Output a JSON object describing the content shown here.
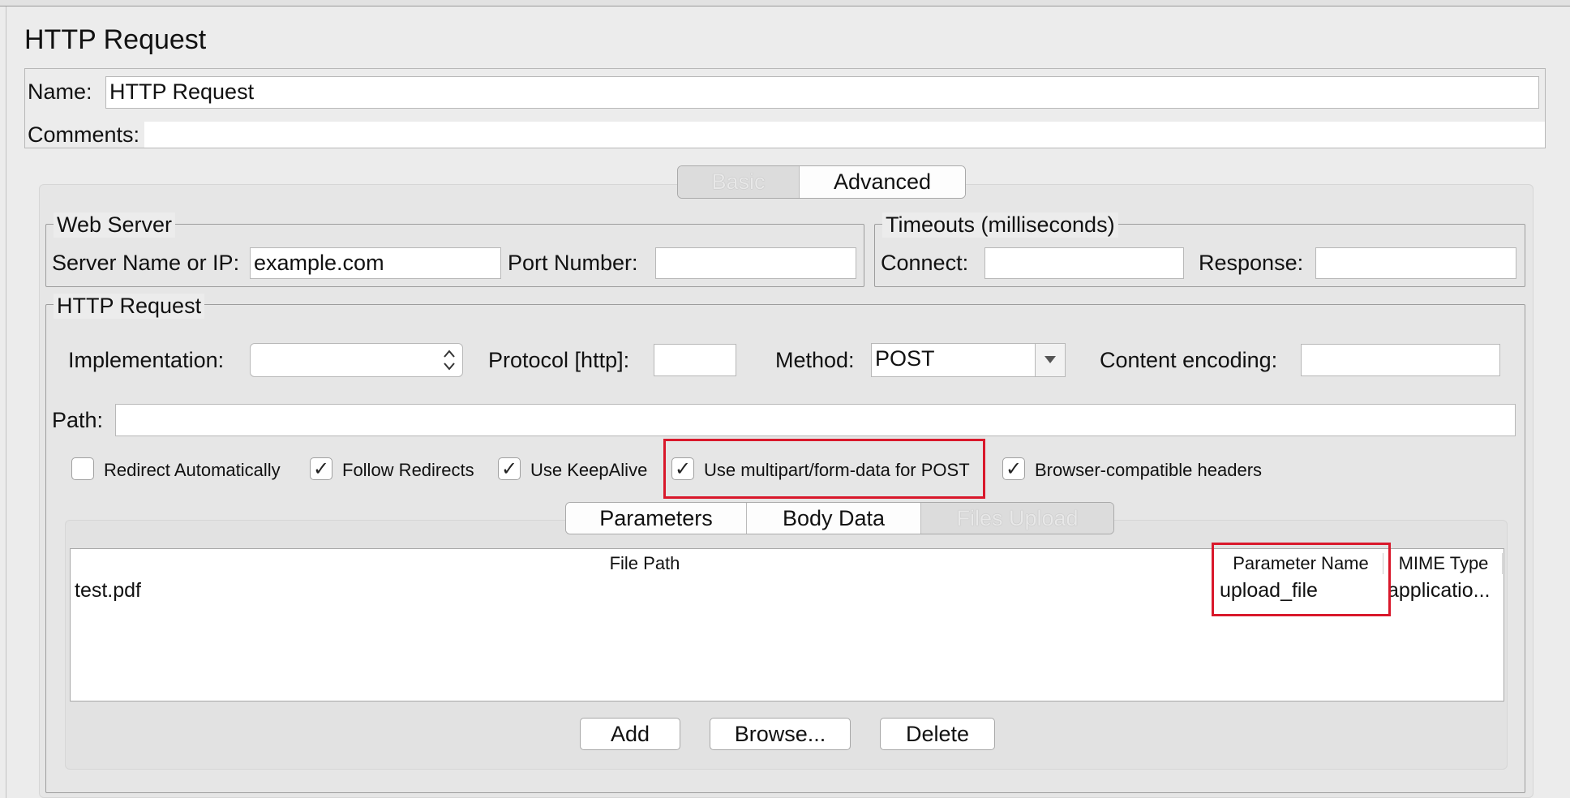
{
  "title": "HTTP Request",
  "name_label": "Name:",
  "name_value": "HTTP Request",
  "comments_label": "Comments:",
  "comments_value": "",
  "top_tabs": [
    {
      "label": "Basic",
      "disabled": true
    },
    {
      "label": "Advanced",
      "disabled": false
    }
  ],
  "web_server": {
    "legend": "Web Server",
    "server_label": "Server Name or IP:",
    "server_value": "example.com",
    "port_label": "Port Number:",
    "port_value": ""
  },
  "timeouts": {
    "legend": "Timeouts (milliseconds)",
    "connect_label": "Connect:",
    "connect_value": "",
    "response_label": "Response:",
    "response_value": ""
  },
  "http_request": {
    "legend": "HTTP Request",
    "implementation_label": "Implementation:",
    "implementation_value": "",
    "protocol_label": "Protocol [http]:",
    "protocol_value": "",
    "method_label": "Method:",
    "method_value": "POST",
    "encoding_label": "Content encoding:",
    "encoding_value": "",
    "path_label": "Path:",
    "path_value": ""
  },
  "checkboxes": [
    {
      "label": "Redirect Automatically",
      "checked": false
    },
    {
      "label": "Follow Redirects",
      "checked": true
    },
    {
      "label": "Use KeepAlive",
      "checked": true
    },
    {
      "label": "Use multipart/form-data for POST",
      "checked": true
    },
    {
      "label": "Browser-compatible headers",
      "checked": true
    }
  ],
  "check_mark": "✓",
  "dropdown_arrow": "▼",
  "spinner_arrows": "⌃⌄",
  "inner_tabs": [
    {
      "label": "Parameters",
      "disabled": false
    },
    {
      "label": "Body Data",
      "disabled": false
    },
    {
      "label": "Files Upload",
      "disabled": true
    }
  ],
  "files_table": {
    "columns": [
      "File Path",
      "Parameter Name",
      "MIME Type"
    ],
    "rows": [
      {
        "file_path": "test.pdf",
        "parameter_name": "upload_file",
        "mime_type": "applicatio..."
      }
    ]
  },
  "buttons": {
    "add": "Add",
    "browse": "Browse...",
    "delete": "Delete"
  },
  "colors": {
    "highlight": "#d9182b",
    "background": "#ececec"
  }
}
